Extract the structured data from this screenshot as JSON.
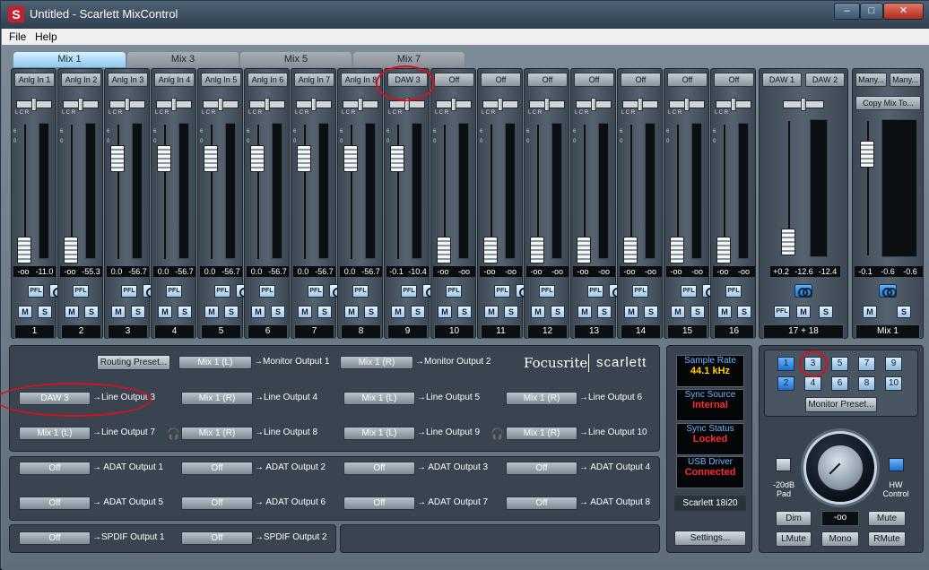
{
  "window": {
    "title": "Untitled - Scarlett MixControl",
    "app_icon_letter": "S",
    "controls": [
      "–",
      "□",
      "✕"
    ]
  },
  "menu": {
    "file": "File",
    "help": "Help"
  },
  "tabs": [
    "Mix 1",
    "Mix 3",
    "Mix 5",
    "Mix 7"
  ],
  "active_tab": "Mix 1",
  "channels": [
    {
      "src": "Anlg In 1",
      "v1": "-oo",
      "v2": "-11.0",
      "num": "1"
    },
    {
      "src": "Anlg In 2",
      "v1": "-oo",
      "v2": "-55.3",
      "num": "2"
    },
    {
      "src": "Anlg In 3",
      "v1": "0.0",
      "v2": "-56.7",
      "num": "3"
    },
    {
      "src": "Anlg In 4",
      "v1": "0.0",
      "v2": "-56.7",
      "num": "4"
    },
    {
      "src": "Anlg In 5",
      "v1": "0.0",
      "v2": "-56.7",
      "num": "5"
    },
    {
      "src": "Anlg In 6",
      "v1": "0.0",
      "v2": "-56.7",
      "num": "6"
    },
    {
      "src": "Anlg In 7",
      "v1": "0.0",
      "v2": "-56.7",
      "num": "7"
    },
    {
      "src": "Anlg In 8",
      "v1": "0.0",
      "v2": "-56.7",
      "num": "8"
    },
    {
      "src": "DAW 3",
      "v1": "-0.1",
      "v2": "-10.4",
      "num": "9"
    },
    {
      "src": "Off",
      "v1": "-oo",
      "v2": "-oo",
      "num": "10"
    },
    {
      "src": "Off",
      "v1": "-oo",
      "v2": "-oo",
      "num": "11"
    },
    {
      "src": "Off",
      "v1": "-oo",
      "v2": "-oo",
      "num": "12"
    },
    {
      "src": "Off",
      "v1": "-oo",
      "v2": "-oo",
      "num": "13"
    },
    {
      "src": "Off",
      "v1": "-oo",
      "v2": "-oo",
      "num": "14"
    },
    {
      "src": "Off",
      "v1": "-oo",
      "v2": "-oo",
      "num": "15"
    },
    {
      "src": "Off",
      "v1": "-oo",
      "v2": "-oo",
      "num": "16"
    }
  ],
  "channel_controls": {
    "pfl": "PFL",
    "mute": "M",
    "solo": "S",
    "scale_top": "6",
    "scale_mid": "0",
    "lcr": "L  C  R"
  },
  "daw_strip": {
    "src_l": "DAW 1",
    "src_r": "DAW 2",
    "v1": "+0.2",
    "v2": "-12.6",
    "v3": "-12.4",
    "num": "17 + 18"
  },
  "master_strip": {
    "src_l": "Many...",
    "src_r": "Many...",
    "copy": "Copy Mix To...",
    "v1": "-0.1",
    "v2": "-0.6",
    "v3": "-0.6",
    "num": "Mix 1"
  },
  "routing": {
    "preset_button": "Routing Preset...",
    "brand": "Focusrite",
    "brand2": "scarlett",
    "row1": [
      {
        "src": "Mix 1 (L)",
        "dest": "→Monitor Output 1"
      },
      {
        "src": "Mix 1 (R)",
        "dest": "→Monitor Output 2"
      }
    ],
    "line_rows": [
      [
        {
          "src": "DAW 3",
          "dest": "→Line Output 3"
        },
        {
          "src": "Mix 1 (R)",
          "dest": "→Line Output 4"
        },
        {
          "src": "Mix 1 (L)",
          "dest": "→Line Output 5"
        },
        {
          "src": "Mix 1 (R)",
          "dest": "→Line Output 6"
        }
      ],
      [
        {
          "src": "Mix 1 (L)",
          "dest": "→Line Output 7"
        },
        {
          "src": "Mix 1 (R)",
          "dest": "→Line Output 8"
        },
        {
          "src": "Mix 1 (L)",
          "dest": "→Line Output 9"
        },
        {
          "src": "Mix 1 (R)",
          "dest": "→Line Output 10"
        }
      ]
    ],
    "adat_rows": [
      [
        {
          "src": "Off",
          "dest": "→ ADAT Output 1"
        },
        {
          "src": "Off",
          "dest": "→ ADAT Output 2"
        },
        {
          "src": "Off",
          "dest": "→ ADAT Output 3"
        },
        {
          "src": "Off",
          "dest": "→ ADAT Output 4"
        }
      ],
      [
        {
          "src": "Off",
          "dest": "→ ADAT Output 5"
        },
        {
          "src": "Off",
          "dest": "→ ADAT Output 6"
        },
        {
          "src": "Off",
          "dest": "→ ADAT Output 7"
        },
        {
          "src": "Off",
          "dest": "→ ADAT Output 8"
        }
      ]
    ],
    "spdif_row": [
      {
        "src": "Off",
        "dest": "→SPDIF Output 1"
      },
      {
        "src": "Off",
        "dest": "→SPDIF Output 2"
      }
    ]
  },
  "status": {
    "sample_rate_label": "Sample Rate",
    "sample_rate": "44.1 kHz",
    "sync_source_label": "Sync Source",
    "sync_source": "Internal",
    "sync_status_label": "Sync Status",
    "sync_status": "Locked",
    "usb_label": "USB  Driver",
    "usb_status": "Connected",
    "device": "Scarlett 18i20",
    "settings_button": "Settings...",
    "colors": {
      "rate": "#ffd000",
      "red": "#ff2a2a",
      "label": "#6fb8ff"
    }
  },
  "monitor": {
    "buttons_top": [
      "1",
      "3",
      "5",
      "7",
      "9"
    ],
    "buttons_bottom": [
      "2",
      "4",
      "6",
      "8",
      "10"
    ],
    "preset_button": "Monitor Preset...",
    "pad_label": "-20dB Pad",
    "hw_label": "HW Control",
    "dim": "Dim",
    "level": "-oo",
    "mute": "Mute",
    "lmute": "LMute",
    "mono": "Mono",
    "rmute": "RMute"
  }
}
